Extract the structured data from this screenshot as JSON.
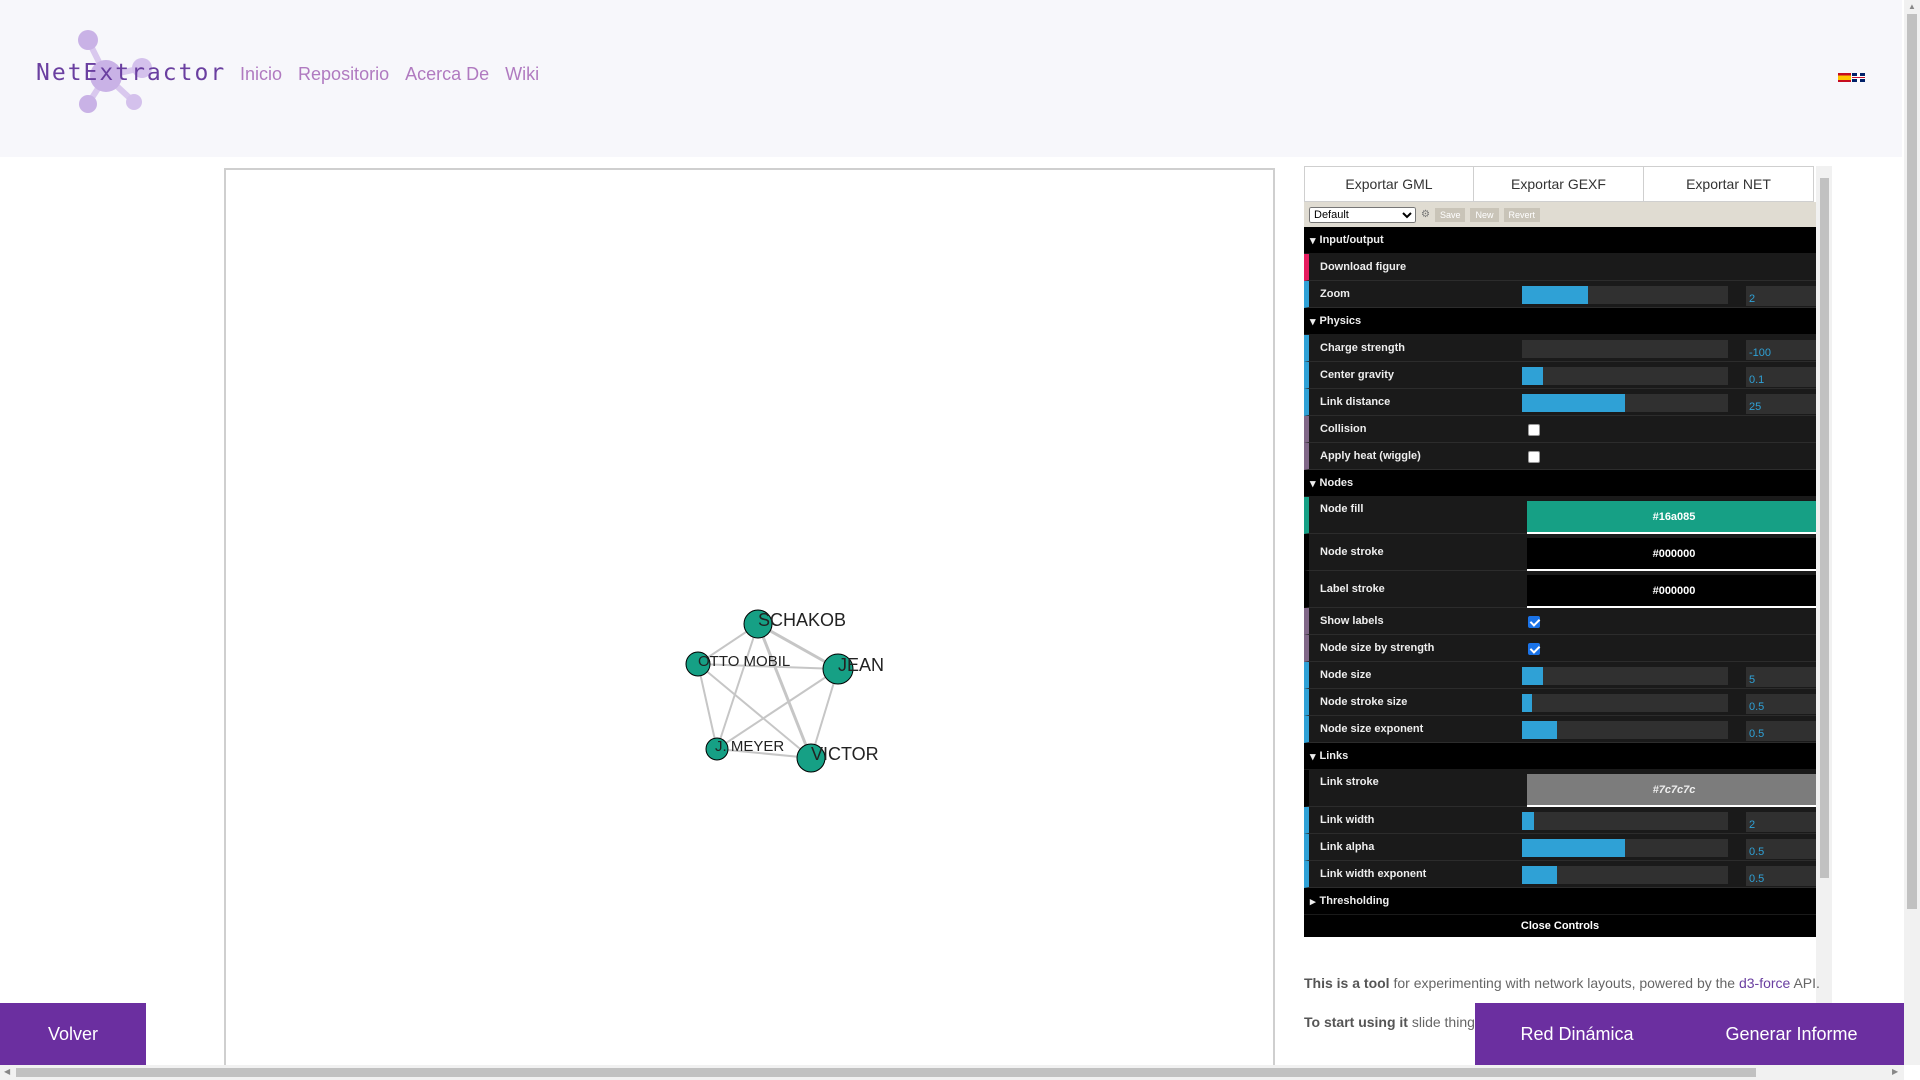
{
  "header": {
    "logo_text": "NetExtractor",
    "nav": [
      "Inicio",
      "Repositorio",
      "Acerca De",
      "Wiki"
    ]
  },
  "graph": {
    "nodes": [
      {
        "label": "SCHAKOB"
      },
      {
        "label": "OTTO MOBIL"
      },
      {
        "label": "JEAN"
      },
      {
        "label": "J. MEYER"
      },
      {
        "label": "VICTOR"
      }
    ],
    "node_fill": "#16a085",
    "link_color": "#c6c6c6"
  },
  "panel": {
    "tabs": [
      "Exportar GML",
      "Exportar GEXF",
      "Exportar NET"
    ],
    "preset": {
      "selected": "Default",
      "save": "Save",
      "new": "New",
      "revert": "Revert"
    },
    "folders": {
      "io": "Input/output",
      "physics": "Physics",
      "nodes": "Nodes",
      "links": "Links",
      "thresholding": "Thresholding"
    },
    "controls": {
      "download_figure": "Download figure",
      "zoom": {
        "label": "Zoom",
        "value": "2",
        "fraction": 0.32
      },
      "charge_strength": {
        "label": "Charge strength",
        "value": "-100",
        "fraction": 0.0
      },
      "center_gravity": {
        "label": "Center gravity",
        "value": "0.1",
        "fraction": 0.1
      },
      "link_distance": {
        "label": "Link distance",
        "value": "25",
        "fraction": 0.5
      },
      "collision": {
        "label": "Collision",
        "checked": false
      },
      "apply_heat": {
        "label": "Apply heat (wiggle)",
        "checked": false
      },
      "node_fill": {
        "label": "Node fill",
        "value": "#16a085"
      },
      "node_stroke": {
        "label": "Node stroke",
        "value": "#000000"
      },
      "label_stroke": {
        "label": "Label stroke",
        "value": "#000000"
      },
      "show_labels": {
        "label": "Show labels",
        "checked": true
      },
      "node_size_by_strength": {
        "label": "Node size by strength",
        "checked": true
      },
      "node_size": {
        "label": "Node size",
        "value": "5",
        "fraction": 0.1
      },
      "node_stroke_size": {
        "label": "Node stroke size",
        "value": "0.5",
        "fraction": 0.05
      },
      "node_size_exponent": {
        "label": "Node size exponent",
        "value": "0.5",
        "fraction": 0.17
      },
      "link_stroke": {
        "label": "Link stroke",
        "value": "#7c7c7c"
      },
      "link_width": {
        "label": "Link width",
        "value": "2",
        "fraction": 0.06
      },
      "link_alpha": {
        "label": "Link alpha",
        "value": "0.5",
        "fraction": 0.5
      },
      "link_width_exponent": {
        "label": "Link width exponent",
        "value": "0.5",
        "fraction": 0.17
      }
    },
    "close_controls": "Close Controls"
  },
  "description": {
    "p1_bold": "This is a tool",
    "p1_text": " for experimenting with network layouts, powered by the ",
    "p1_link": "d3-force",
    "p1_end": " API.",
    "p2_bold": "To start using it",
    "p2_text": " slide things... own data by linking to it or ... can download it."
  },
  "buttons": {
    "volver": "Volver",
    "red_dinamica": "Red Dinámica",
    "generar_informe": "Generar Informe"
  }
}
